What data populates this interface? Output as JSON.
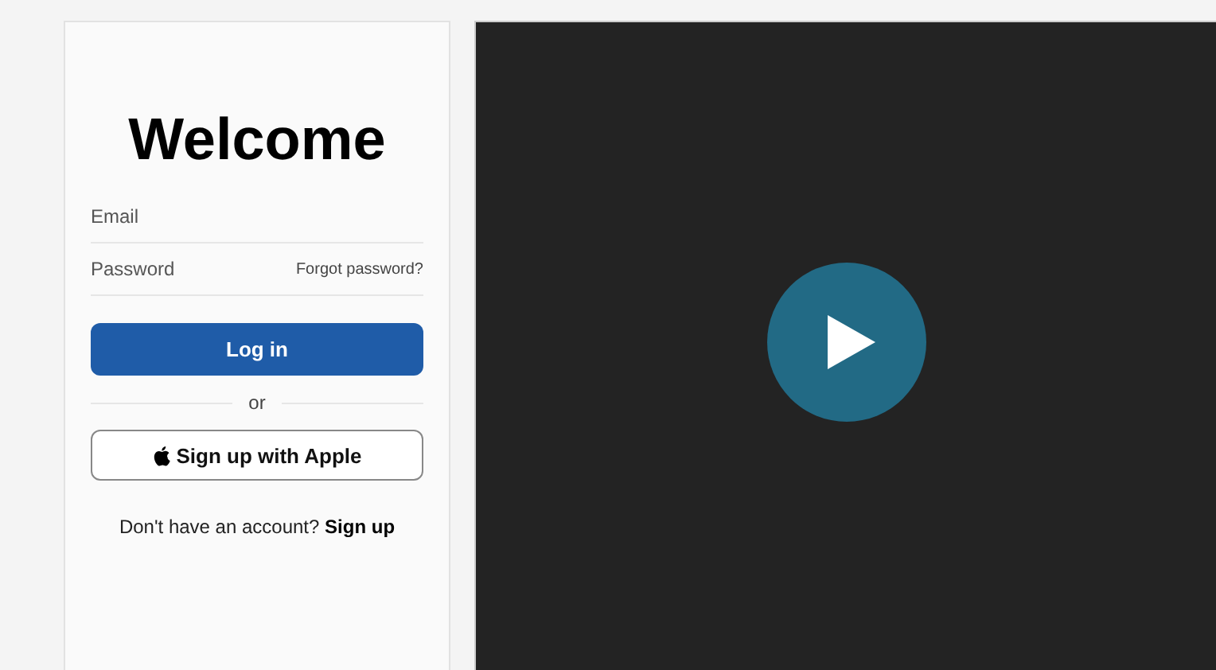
{
  "login": {
    "title": "Welcome",
    "fields": [
      {
        "placeholder": "Email"
      },
      {
        "placeholder": "Password",
        "link": "Forgot password?"
      }
    ],
    "submit": "Log in",
    "divider": "or",
    "apple_button": "Sign up with Apple",
    "signup_prompt": "Don't have an account?",
    "signup_link": "Sign up"
  },
  "video": {
    "kind": "player"
  }
}
